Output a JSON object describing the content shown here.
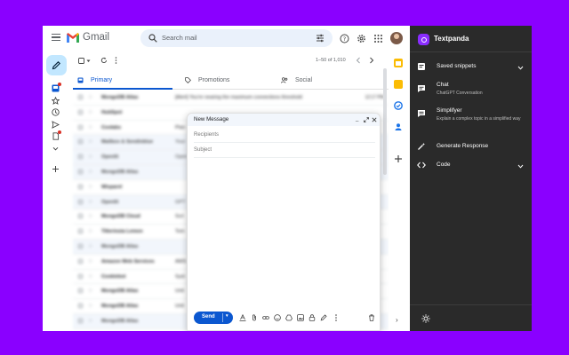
{
  "gmail": {
    "app_title": "Gmail",
    "search": {
      "placeholder": "Search mail"
    },
    "pager": "1–50 of 1,010",
    "tabs": [
      {
        "label": "Primary",
        "icon": "inbox-icon",
        "active": true
      },
      {
        "label": "Promotions",
        "icon": "tag-icon",
        "active": false
      },
      {
        "label": "Social",
        "icon": "people-icon",
        "active": false
      }
    ],
    "rows": [
      {
        "sender": "MongoDB Atlas",
        "subject": "[Alert] You're nearing the maximum connections threshold",
        "time": "12:17 PM",
        "read": false
      },
      {
        "sender": "HubSpot",
        "subject": "",
        "time": "",
        "read": false
      },
      {
        "sender": "Coolabs",
        "subject": "Plan",
        "time": "",
        "read": false
      },
      {
        "sender": "Mailbox & Sendinblue",
        "subject": "Your",
        "time": "",
        "read": true
      },
      {
        "sender": "Openlit",
        "subject": "Open",
        "time": "",
        "read": true
      },
      {
        "sender": "MongoDB Atlas",
        "subject": "",
        "time": "",
        "read": true
      },
      {
        "sender": "Wisparel",
        "subject": "",
        "time": "",
        "read": false
      },
      {
        "sender": "Openlit",
        "subject": "GPT",
        "time": "",
        "read": true
      },
      {
        "sender": "MongoDB Cloud",
        "subject": "Scri",
        "time": "",
        "read": false
      },
      {
        "sender": "Tilterinsta Lemon",
        "subject": "Tom",
        "time": "",
        "read": false
      },
      {
        "sender": "MongoDB Atlas",
        "subject": "",
        "time": "",
        "read": true
      },
      {
        "sender": "Amazon Web Services",
        "subject": "AWS",
        "time": "",
        "read": false
      },
      {
        "sender": "Cookiebot",
        "subject": "Syst",
        "time": "",
        "read": false
      },
      {
        "sender": "MongoDB Atlas",
        "subject": "Unit",
        "time": "",
        "read": false
      },
      {
        "sender": "MongoDB Atlas",
        "subject": "Unit",
        "time": "",
        "read": false
      },
      {
        "sender": "MongoDB Atlas",
        "subject": "",
        "time": "",
        "read": true
      }
    ]
  },
  "compose": {
    "title": "New Message",
    "recipients_placeholder": "Recipients",
    "subject_placeholder": "Subject",
    "send_label": "Send"
  },
  "panel": {
    "title": "Textpanda",
    "items": [
      {
        "label": "Saved snippets",
        "sub": "",
        "icon": "snippet-icon",
        "expandable": true
      },
      {
        "label": "Chat",
        "sub": "ChatGPT Conversation",
        "icon": "chat-icon",
        "expandable": false
      },
      {
        "label": "Simplifyer",
        "sub": "Explain a complex topic in a simplified way",
        "icon": "simplify-icon",
        "expandable": false
      },
      {
        "label": "Generate Response",
        "sub": "",
        "icon": "magic-wand-icon",
        "expandable": false
      },
      {
        "label": "Code",
        "sub": "",
        "icon": "code-icon",
        "expandable": true
      }
    ]
  },
  "colors": {
    "background": "#8a00ff",
    "accent": "#0b57d0",
    "panel_bg": "#2a2a2a",
    "brand": "#8a2cff"
  }
}
